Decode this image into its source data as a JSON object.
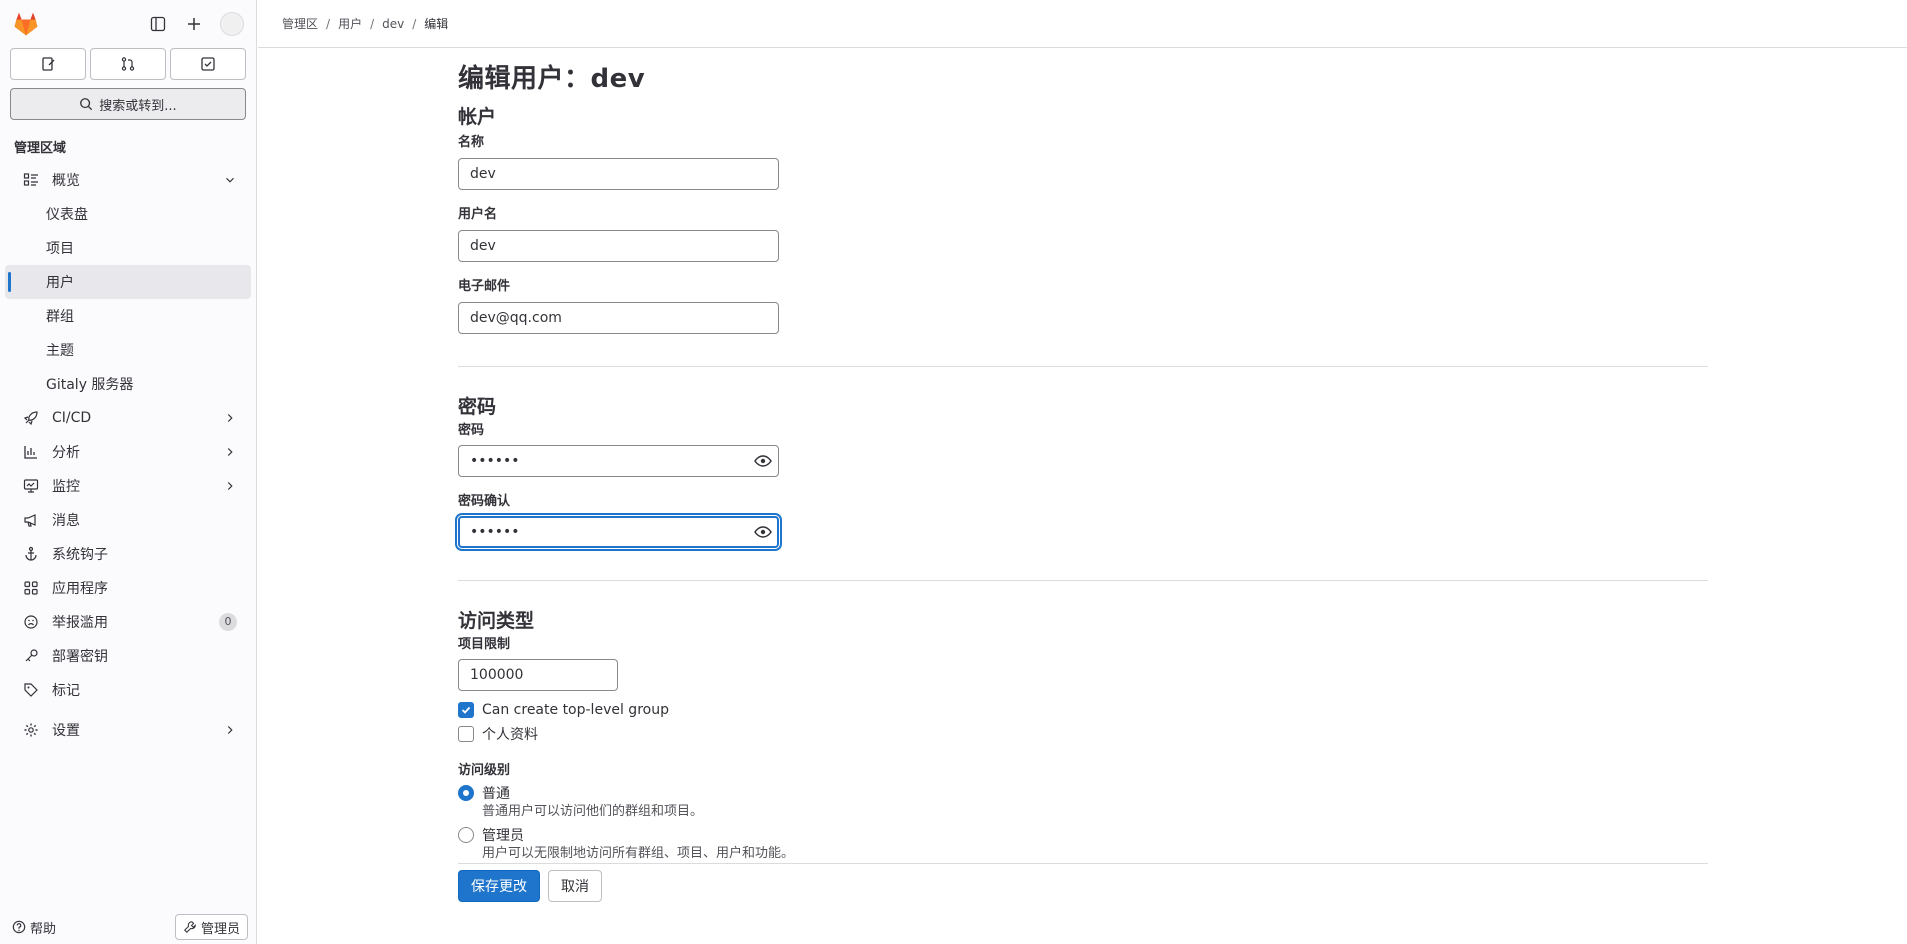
{
  "breadcrumb": [
    "管理区",
    "用户",
    "dev",
    "编辑"
  ],
  "sidebar": {
    "search_label": "搜索或转到...",
    "section_title": "管理区域",
    "overview": "概览",
    "sub_items": [
      "仪表盘",
      "项目",
      "用户",
      "群组",
      "主题",
      "Gitaly 服务器"
    ],
    "items": [
      "CI/CD",
      "分析",
      "监控",
      "消息",
      "系统钩子",
      "应用程序",
      "举报滥用",
      "部署密钥",
      "标记",
      "设置"
    ],
    "abuse_count": "0",
    "help": "帮助",
    "admin": "管理员"
  },
  "page": {
    "title": "编辑用户：dev",
    "account": {
      "heading": "帐户",
      "name_label": "名称",
      "name_value": "dev",
      "username_label": "用户名",
      "username_value": "dev",
      "email_label": "电子邮件",
      "email_value": "dev@qq.com"
    },
    "password": {
      "heading": "密码",
      "password_label": "密码",
      "password_value": "••••••",
      "confirm_label": "密码确认",
      "confirm_value": "••••••"
    },
    "access": {
      "heading": "访问类型",
      "project_limit_label": "项目限制",
      "project_limit_value": "100000",
      "can_create_group": "Can create top-level group",
      "private_profile": "个人资料",
      "level_label": "访问级别",
      "regular": "普通",
      "regular_help": "普通用户可以访问他们的群组和项目。",
      "admin": "管理员",
      "admin_help": "用户可以无限制地访问所有群组、项目、用户和功能。"
    },
    "save_button": "保存更改",
    "cancel_button": "取消"
  }
}
